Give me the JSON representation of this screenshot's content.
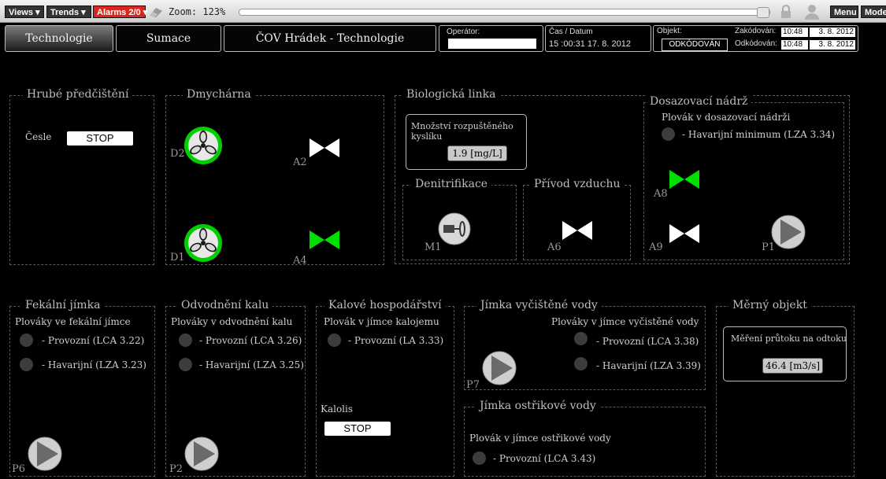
{
  "toolbar": {
    "views": "Views ▾",
    "trends": "Trends ▾",
    "alarms": "Alarms 2/0 ▾",
    "zoom": "Zoom: 123%",
    "menu": "Menu",
    "mode": "Mode"
  },
  "header": {
    "nav_technologie": "Technologie",
    "nav_sumace": "Sumace",
    "title": "ČOV Hrádek - Technologie",
    "operator_label": "Operátor:",
    "operator_value": "",
    "datetime_label": "Čas / Datum",
    "datetime_value": "15 :00:31   17. 8. 2012",
    "object_label": "Objekt:",
    "object_status": "ODKÓDOVÁN",
    "coded_label": "Zakódován:",
    "coded_time": "10:48",
    "coded_date": "3. 8. 2012",
    "decoded_label": "Odkódován:",
    "decoded_time": "10:48",
    "decoded_date": "3. 8. 2012"
  },
  "groups": {
    "hrube": {
      "title": "Hrubé předčištění",
      "cesle": "Česle",
      "stop": "STOP"
    },
    "dmychar": {
      "title": "Dmychárna",
      "d1": "D1",
      "d2": "D2",
      "a2": "A2",
      "a4": "A4"
    },
    "bio": {
      "title": "Biologická linka",
      "oxygen_label": "Množství rozpuštěného kyslíku",
      "oxygen_value": "1.9 [mg/L]",
      "denitr": "Denitrifikace",
      "m1": "M1",
      "privod": "Přívod vzduchu",
      "a6": "A6",
      "dosaz": "Dosazovací nádrž",
      "dosaz_float": "Plovák v dosazovací nádrži",
      "dosaz_min": "- Havarijní minimum (LZA 3.34)",
      "a8": "A8",
      "a9": "A9",
      "p1": "P1"
    },
    "fekal": {
      "title": "Fekální jímka",
      "floats": "Plováky ve fekální jímce",
      "prov": "- Provozní (LCA 3.22)",
      "hav": "- Havarijní (LZA 3.23)",
      "p6": "P6"
    },
    "odvod": {
      "title": "Odvodnění kalu",
      "floats": "Plováky v odvodnění kalu",
      "prov": "- Provozní (LCA 3.26)",
      "hav": "- Havarijní (LZA 3.25)",
      "p2": "P2"
    },
    "kalove": {
      "title": "Kalové hospodářství",
      "float": "Plovák v jímce kalojemu",
      "prov": "- Provozní (LA 3.33)",
      "kalolis": "Kalolis",
      "stop": "STOP"
    },
    "vycist": {
      "title": "Jímka vyčištěné vody",
      "floats": "Plováky v jímce vyčistěné vody",
      "prov": "- Provozní (LCA 3.38)",
      "hav": "- Havarijní (LZA 3.39)",
      "p7": "P7"
    },
    "ostrik": {
      "title": "Jímka ostřikové vody",
      "float": "Plovák v jímce ostřikové vody",
      "prov": "- Provozní (LCA 3.43)"
    },
    "merny": {
      "title": "Měrný objekt",
      "flow_label": "Měření průtoku na odtoku",
      "flow_value": "46.4 [m3/s]"
    }
  },
  "colors": {
    "active_green": "#00e000",
    "inactive": "#ffffff",
    "indicator_off": "#3c3c3c",
    "alarm_red": "#d9271f"
  }
}
